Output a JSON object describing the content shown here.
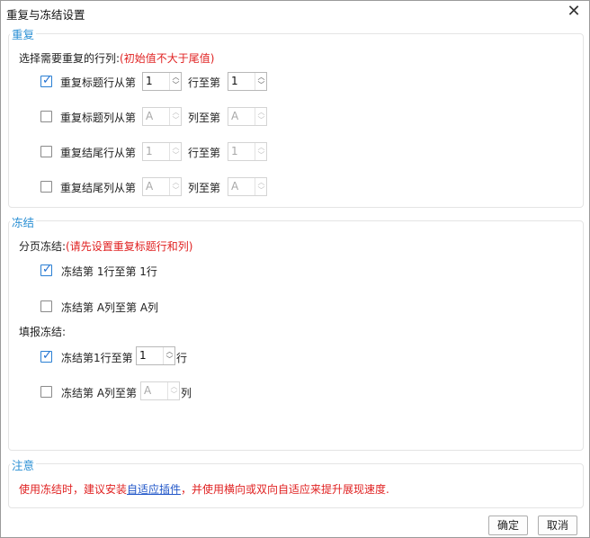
{
  "window": {
    "title": "重复与冻结设置",
    "close_glyph": "✕"
  },
  "repeat": {
    "title": "重复",
    "prompt_label": "选择需要重复的行列:",
    "prompt_hint": "(初始值不大于尾值)",
    "rows": [
      {
        "label_before": "重复标题行从第",
        "from": "1",
        "label_mid": "行至第",
        "to": "1",
        "checked": true,
        "enabled": true
      },
      {
        "label_before": "重复标题列从第",
        "from": "A",
        "label_mid": "列至第",
        "to": "A",
        "checked": false,
        "enabled": false
      },
      {
        "label_before": "重复结尾行从第",
        "from": "1",
        "label_mid": "行至第",
        "to": "1",
        "checked": false,
        "enabled": false
      },
      {
        "label_before": "重复结尾列从第",
        "from": "A",
        "label_mid": "列至第",
        "to": "A",
        "checked": false,
        "enabled": false
      }
    ]
  },
  "freeze": {
    "title": "冻结",
    "paging_label": "分页冻结:",
    "paging_hint": "(请先设置重复标题行和列)",
    "paging_items": [
      {
        "label": "冻结第 1行至第  1行",
        "checked": true
      },
      {
        "label": "冻结第  A列至第  A列",
        "checked": false
      }
    ],
    "fill_label": "填报冻结:",
    "fill_rows": {
      "label": "冻结第1行至第",
      "value": "1",
      "suffix": "行",
      "checked": true
    },
    "fill_cols": {
      "label": "冻结第  A列至第",
      "value": "A",
      "suffix": "列",
      "checked": false
    }
  },
  "note": {
    "title": "注意",
    "text_before": "使用冻结时，建议安装",
    "link": "自适应插件",
    "text_after": "，并使用横向或双向自适应来提升展现速度."
  },
  "buttons": {
    "ok": "确定",
    "cancel": "取消"
  },
  "colors": {
    "accent": "#2a8fd4",
    "warning": "#e02222",
    "link": "#1f55c8"
  },
  "icons": {
    "check": "✓",
    "spin_up": "︿",
    "spin_down": "﹀"
  }
}
